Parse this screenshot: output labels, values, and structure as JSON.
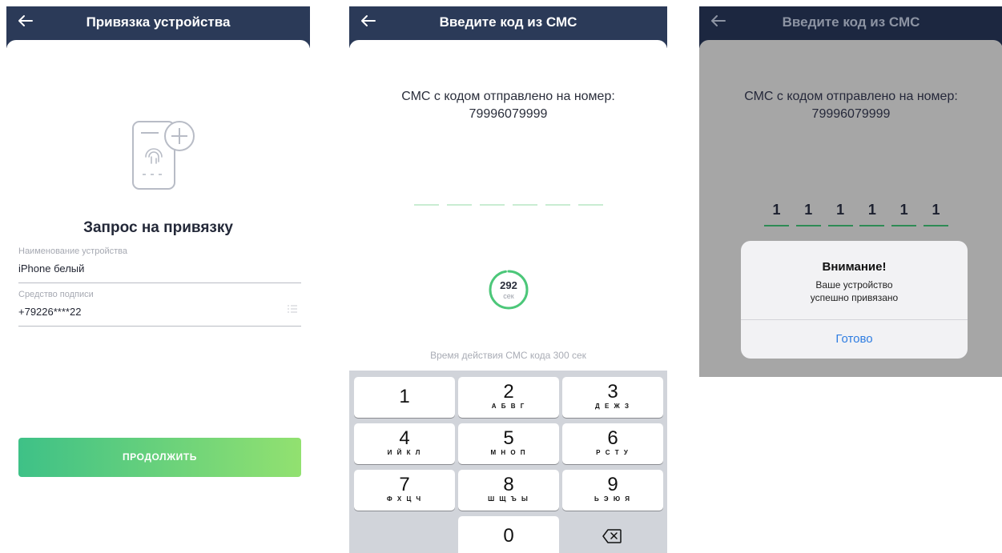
{
  "screen1": {
    "title": "Привязка устройства",
    "back_icon": "arrow-left-icon",
    "illustration_icon": "phone-fingerprint-add-icon",
    "heading": "Запрос на привязку",
    "device_field": {
      "label": "Наименование устройства",
      "value": "iPhone белый"
    },
    "sign_field": {
      "label": "Средство подписи",
      "value": "+79226****22",
      "icon": "list-icon"
    },
    "continue_label": "ПРОДОЛЖИТЬ"
  },
  "screen2": {
    "title": "Введите код из СМС",
    "back_icon": "arrow-left-icon",
    "sms_text": "СМС с кодом отправлено на номер:",
    "phone": "79996079999",
    "code_slots": 6,
    "timer": {
      "value": "292",
      "unit": "сек",
      "total_seconds": 300
    },
    "validity_text": "Время действия СМС кода 300 сек",
    "keypad": [
      {
        "digit": "1",
        "letters": ""
      },
      {
        "digit": "2",
        "letters": "А Б В Г"
      },
      {
        "digit": "3",
        "letters": "Д Е Ж З"
      },
      {
        "digit": "4",
        "letters": "И Й К Л"
      },
      {
        "digit": "5",
        "letters": "М Н О П"
      },
      {
        "digit": "6",
        "letters": "Р С Т У"
      },
      {
        "digit": "7",
        "letters": "Ф Х Ц Ч"
      },
      {
        "digit": "8",
        "letters": "Ш Щ Ъ Ы"
      },
      {
        "digit": "9",
        "letters": "Ь Э Ю Я"
      },
      {
        "digit": "0",
        "letters": ""
      }
    ],
    "backspace_icon": "backspace-icon"
  },
  "screen3": {
    "title": "Введите код из СМС",
    "back_icon": "arrow-left-icon",
    "sms_text": "СМС с кодом отправлено на номер:",
    "phone": "79996079999",
    "code_digits": [
      "1",
      "1",
      "1",
      "1",
      "1",
      "1"
    ],
    "alert": {
      "title": "Внимание!",
      "message_line1": "Ваше устройство",
      "message_line2": "успешно привязано",
      "ok_label": "Готово"
    }
  },
  "colors": {
    "header": "#2b3a58",
    "accent_green": "#3ec187",
    "accent_green_light": "#92e170",
    "link_blue": "#2f7de1",
    "overlay": "#a6a6a6"
  }
}
